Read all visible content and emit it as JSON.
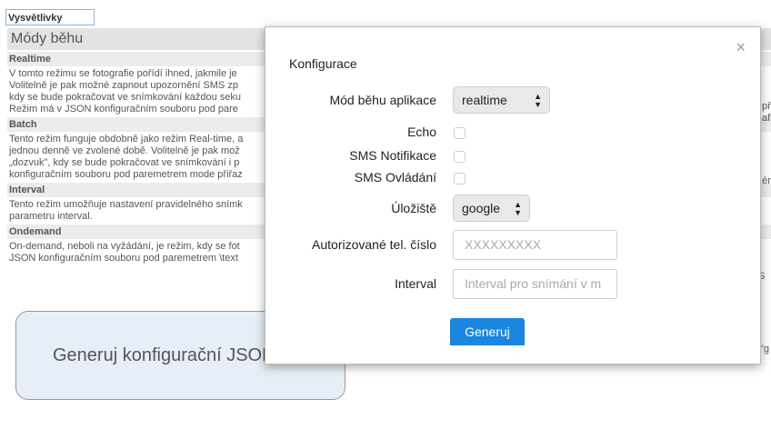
{
  "tab": {
    "label": "Vysvětlivky"
  },
  "section": {
    "title": "Módy běhu"
  },
  "modes": [
    {
      "title": "Realtime",
      "text": "V tomto režimu se fotografie pořídí ihned, jakmile je\nVolitelně je pak možné zapnout upozornění SMS zp\nkdy se bude pokračovat ve snímkování každou seku\nRežim má v JSON konfiguračním souboru pod pare"
    },
    {
      "title": "Batch",
      "text": "Tento režim funguje obdobně jako režim Real-time, a\njednou denně ve zvolené době. Volitelně je pak mož\n„dozvuk\", kdy se bude pokračovat ve snímkování i p\nkonfiguračním souboru pod paremetrem mode přiřaz"
    },
    {
      "title": "Interval",
      "text": "Tento režim umožňuje nastavení pravidelného snímk\nparametru interval."
    },
    {
      "title": "Ondemand",
      "text": "On-demand, neboli na vyžádání, je režim, kdy se fot\nJSON konfiguračním souboru pod paremetrem \\text"
    }
  ],
  "right_fragments": [
    "př",
    "afi",
    "ém",
    "S",
    "\"g"
  ],
  "big_button": {
    "label": "Generuj konfigurační JSON"
  },
  "modal": {
    "title": "Konfigurace",
    "close": "×",
    "mode_label": "Mód běhu aplikace",
    "mode_value": "realtime",
    "echo_label": "Echo",
    "sms_notify_label": "SMS Notifikace",
    "sms_control_label": "SMS Ovládání",
    "storage_label": "Úložiště",
    "storage_value": "google",
    "phone_label": "Autorizované tel. číslo",
    "phone_placeholder": "XXXXXXXXX",
    "interval_label": "Interval",
    "interval_placeholder": "Interval pro snímání v m",
    "generate_label": "Generuj"
  },
  "colors": {
    "accent": "#1a86e0",
    "header_bg": "#e3e3e3",
    "button_bg": "#e7eef7"
  }
}
